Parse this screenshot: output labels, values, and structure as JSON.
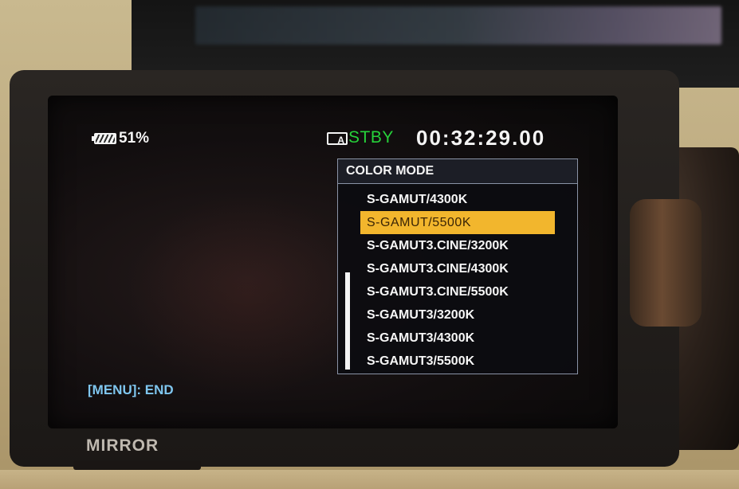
{
  "status": {
    "battery_percent": "51%",
    "media_icon_text": "A",
    "state": "STBY",
    "timecode": "00:32:29.00",
    "colors": {
      "state": "#26d23a",
      "accent_selected": "#f2b62d",
      "hint": "#7fc6ef"
    }
  },
  "menu": {
    "title": "COLOR MODE",
    "items": [
      {
        "label": "S-GAMUT/4300K"
      },
      {
        "label": "S-GAMUT/5500K"
      },
      {
        "label": "S-GAMUT3.CINE/3200K"
      },
      {
        "label": "S-GAMUT3.CINE/4300K"
      },
      {
        "label": "S-GAMUT3.CINE/5500K"
      },
      {
        "label": "S-GAMUT3/3200K"
      },
      {
        "label": "S-GAMUT3/4300K"
      },
      {
        "label": "S-GAMUT3/5500K"
      }
    ],
    "selected_index": 1
  },
  "hint": {
    "end_label": "[MENU]: END"
  },
  "body": {
    "mirror_label": "MIRROR"
  },
  "icons": {
    "battery": "battery-icon",
    "media": "media-card-icon"
  }
}
